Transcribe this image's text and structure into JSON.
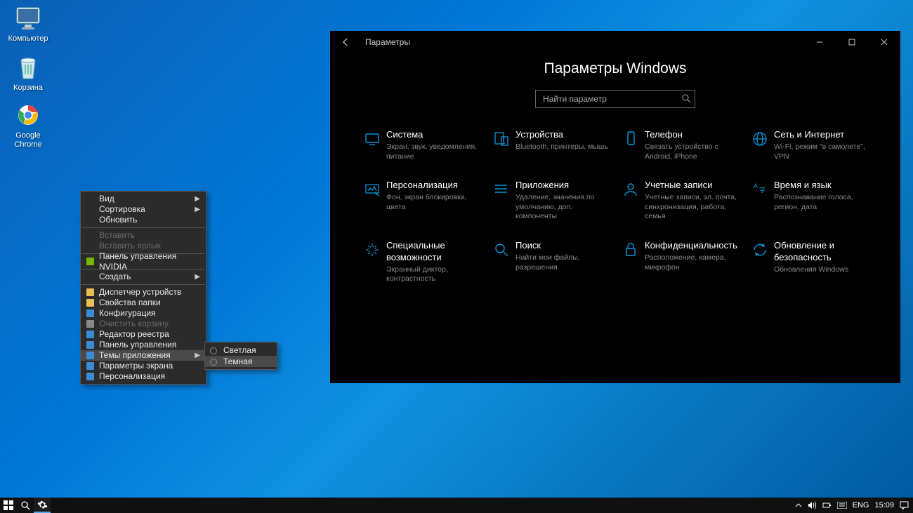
{
  "desktop": {
    "icons": [
      {
        "name": "computer-icon",
        "label": "Компьютер"
      },
      {
        "name": "recycle-bin-icon",
        "label": "Корзина"
      },
      {
        "name": "chrome-icon",
        "label": "Google Chrome"
      }
    ]
  },
  "settings_window": {
    "titlebar_title": "Параметры",
    "heading": "Параметры Windows",
    "search_placeholder": "Найти параметр",
    "categories": [
      {
        "id": "system",
        "title": "Система",
        "desc": "Экран, звук, уведомления, питание"
      },
      {
        "id": "devices",
        "title": "Устройства",
        "desc": "Bluetooth, принтеры, мышь"
      },
      {
        "id": "phone",
        "title": "Телефон",
        "desc": "Связать устройство с Android, iPhone"
      },
      {
        "id": "network",
        "title": "Сеть и Интернет",
        "desc": "Wi-Fi, режим \"в самолете\", VPN"
      },
      {
        "id": "personalization",
        "title": "Персонализация",
        "desc": "Фон, экран блокировки, цвета"
      },
      {
        "id": "apps",
        "title": "Приложения",
        "desc": "Удаление, значения по умолчанию, доп. компоненты"
      },
      {
        "id": "accounts",
        "title": "Учетные записи",
        "desc": "Учетные записи, эл. почта, синхронизация, работа, семья"
      },
      {
        "id": "time",
        "title": "Время и язык",
        "desc": "Распознавание голоса, регион, дата"
      },
      {
        "id": "ease",
        "title": "Специальные возможности",
        "desc": "Экранный диктор, контрастность"
      },
      {
        "id": "search",
        "title": "Поиск",
        "desc": "Найти мои файлы, разрешения"
      },
      {
        "id": "privacy",
        "title": "Конфиденциальность",
        "desc": "Расположение, камера, микрофон"
      },
      {
        "id": "update",
        "title": "Обновление и безопасность",
        "desc": "Обновления Windows"
      }
    ]
  },
  "context_menu": {
    "items": [
      {
        "label": "Вид",
        "arrow": true
      },
      {
        "label": "Сортировка",
        "arrow": true
      },
      {
        "label": "Обновить"
      },
      {
        "sep": true
      },
      {
        "label": "Вставить",
        "disabled": true
      },
      {
        "label": "Вставить ярлык",
        "disabled": true
      },
      {
        "sep": true
      },
      {
        "label": "Панель управления NVIDIA",
        "icon": "nvidia"
      },
      {
        "sep": true
      },
      {
        "label": "Создать",
        "arrow": true
      },
      {
        "sep": true
      },
      {
        "label": "Диспетчер устройств",
        "icon": "devmgr"
      },
      {
        "label": "Свойства папки",
        "icon": "folder"
      },
      {
        "label": "Конфигурация",
        "icon": "config"
      },
      {
        "label": "Очистить корзину",
        "icon": "empty-bin",
        "disabled": true
      },
      {
        "label": "Редактор реестра",
        "icon": "regedit"
      },
      {
        "label": "Панель управления",
        "icon": "cpanel"
      },
      {
        "label": "Темы приложения",
        "icon": "themes",
        "arrow": true,
        "highlight": true
      },
      {
        "label": "Параметры экрана",
        "icon": "display"
      },
      {
        "label": "Персонализация",
        "icon": "personalize"
      }
    ],
    "submenu": {
      "items": [
        {
          "label": "Светлая"
        },
        {
          "label": "Темная",
          "highlight": true
        }
      ]
    }
  },
  "taskbar": {
    "lang": "ENG",
    "clock": "15:09"
  }
}
